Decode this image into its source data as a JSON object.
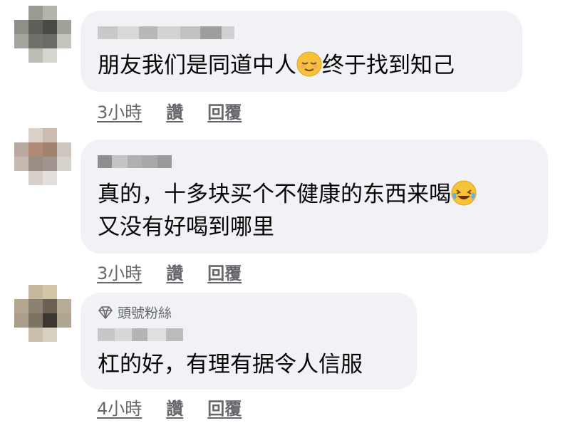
{
  "comments": [
    {
      "text_lines": [
        "朋友我们是同道中人",
        "终于找到知己"
      ],
      "emoji": "relieved-face",
      "time": "3小時",
      "like_label": "讚",
      "reply_label": "回覆"
    },
    {
      "text_lines": [
        "真的，十多块买个不健康的东西来喝",
        "又没有好喝到哪里"
      ],
      "emoji": "tears-of-joy-face",
      "time": "3小時",
      "like_label": "讚",
      "reply_label": "回覆"
    },
    {
      "badge_icon": "diamond-icon",
      "badge": "頭號粉絲",
      "text_lines": [
        "杠的好，有理有据令人信服"
      ],
      "time": "4小時",
      "like_label": "讚",
      "reply_label": "回覆"
    }
  ],
  "colors": {
    "bubble": "#f0f2f5",
    "text": "#050505",
    "secondary": "#65676b"
  }
}
